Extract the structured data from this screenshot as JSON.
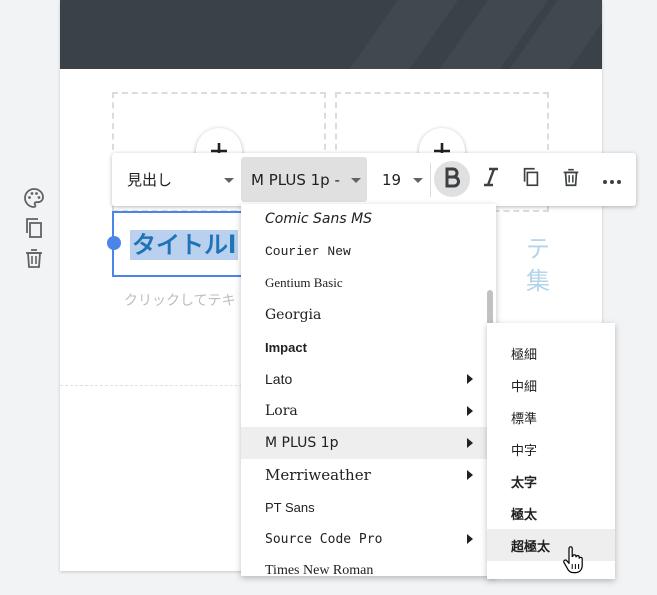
{
  "toolbar": {
    "style_value": "見出し",
    "font_value": "M PLUS 1p -",
    "size_value": "19"
  },
  "title_text": "タイトルl",
  "hint_left": "クリックしてテキ",
  "hint_right_lines": [
    "テ",
    "集"
  ],
  "font_menu": {
    "items": [
      {
        "label": "Comic Sans MS",
        "has_submenu": false
      },
      {
        "label": "Courier New",
        "has_submenu": false
      },
      {
        "label": "Gentium Basic",
        "has_submenu": false
      },
      {
        "label": "Georgia",
        "has_submenu": false
      },
      {
        "label": "Impact",
        "has_submenu": false
      },
      {
        "label": "Lato",
        "has_submenu": true
      },
      {
        "label": "Lora",
        "has_submenu": true
      },
      {
        "label": "M PLUS 1p",
        "has_submenu": true,
        "highlighted": true
      },
      {
        "label": "Merriweather",
        "has_submenu": true
      },
      {
        "label": "PT Sans",
        "has_submenu": false
      },
      {
        "label": "Source Code Pro",
        "has_submenu": true
      },
      {
        "label": "Times New Roman",
        "has_submenu": false
      }
    ]
  },
  "weight_menu": {
    "items": [
      {
        "label": "極細"
      },
      {
        "label": "中細"
      },
      {
        "label": "標準"
      },
      {
        "label": "中字"
      },
      {
        "label": "太字"
      },
      {
        "label": "極太"
      },
      {
        "label": "超極太",
        "highlighted": true
      }
    ]
  },
  "icons": {
    "side": [
      "palette-icon",
      "copy-icon",
      "trash-icon"
    ],
    "toolbar": [
      "bold-icon",
      "italic-icon",
      "copy-icon",
      "trash-icon",
      "more-icon"
    ]
  },
  "colors": {
    "selection_border": "#4a86e8",
    "title_text": "#1f73b7",
    "title_highlight": "#b9d1ee",
    "header_bg": "#3a4247"
  }
}
